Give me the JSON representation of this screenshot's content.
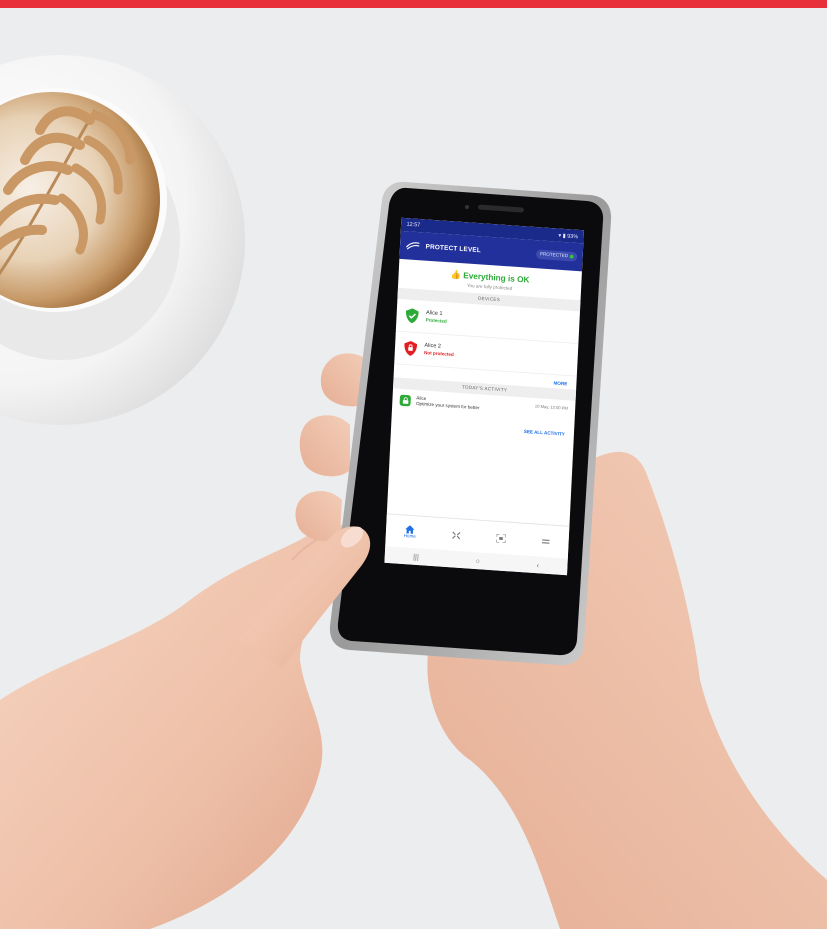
{
  "phone": {
    "status_bar": {
      "time": "12:57",
      "right": "▾ ▮ 93%"
    },
    "app_bar": {
      "title": "PROTECT LEVEL",
      "pill": "PROTECTED"
    },
    "status": {
      "headline": "Everything is OK",
      "subline": "You are fully protected"
    },
    "sections": {
      "devices": "DEVICES",
      "items": [
        {
          "title": "Alice 1",
          "state": "Protected",
          "state_color": "#2eaa38",
          "icon": "shield-check-icon"
        },
        {
          "title": "Alice 2",
          "state": "Not protected",
          "state_color": "#e21d23",
          "icon": "shield-alert-icon"
        }
      ],
      "devices_link": "MORE",
      "activity": "TODAY'S ACTIVITY",
      "activity_item": {
        "title": "Alice",
        "text": "Optimize your system for better",
        "date": "10 May, 12:00 PM"
      },
      "activity_link": "SEE ALL ACTIVITY"
    },
    "bottom_nav": [
      {
        "label": "Home",
        "icon": "home-icon",
        "active": true
      },
      {
        "label": "",
        "icon": "devices-icon",
        "active": false
      },
      {
        "label": "",
        "icon": "scan-icon",
        "active": false
      },
      {
        "label": "",
        "icon": "more-icon",
        "active": false
      }
    ],
    "system_nav": [
      "|||",
      "○",
      "‹"
    ]
  },
  "colors": {
    "accent_red": "#e8303a",
    "app_blue": "#21309a",
    "ok_green": "#2eaa38",
    "alert_red": "#e21d23",
    "link_blue": "#1f6fe6"
  }
}
